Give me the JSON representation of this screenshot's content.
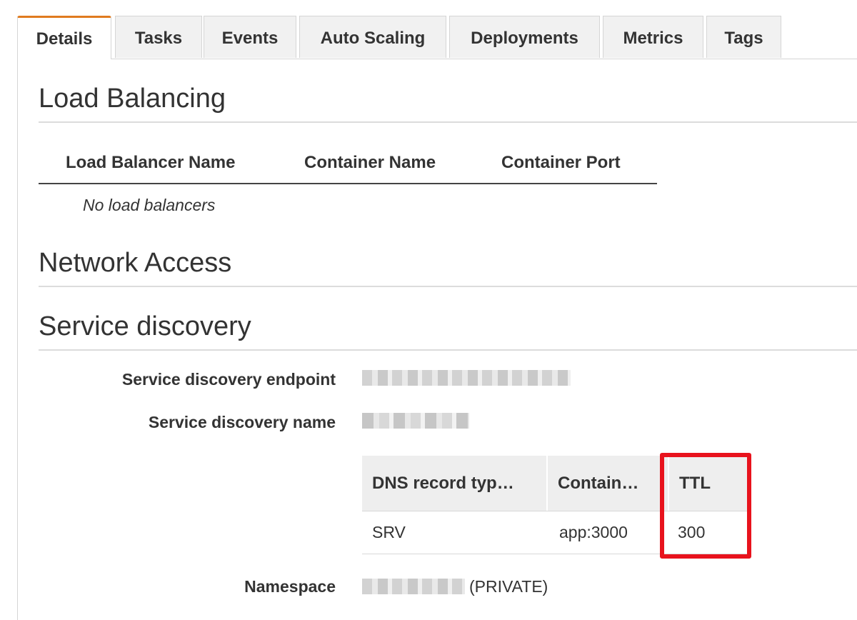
{
  "tabs": [
    {
      "label": "Details",
      "active": true
    },
    {
      "label": "Tasks",
      "active": false
    },
    {
      "label": "Events",
      "active": false
    },
    {
      "label": "Auto Scaling",
      "active": false
    },
    {
      "label": "Deployments",
      "active": false
    },
    {
      "label": "Metrics",
      "active": false
    },
    {
      "label": "Tags",
      "active": false
    }
  ],
  "load_balancing": {
    "title": "Load Balancing",
    "columns": [
      "Load Balancer Name",
      "Container Name",
      "Container Port"
    ],
    "empty_text": "No load balancers"
  },
  "network_access": {
    "title": "Network Access"
  },
  "service_discovery": {
    "title": "Service discovery",
    "endpoint_label": "Service discovery endpoint",
    "name_label": "Service discovery name",
    "dns_table": {
      "columns": [
        "DNS record typ…",
        "Contain…",
        "TTL"
      ],
      "rows": [
        [
          "SRV",
          "app:3000",
          "300"
        ]
      ]
    },
    "namespace_label": "Namespace",
    "namespace_suffix": "(PRIVATE)"
  },
  "colors": {
    "active_tab_accent": "#e07b1f",
    "highlight": "#e8131d"
  }
}
